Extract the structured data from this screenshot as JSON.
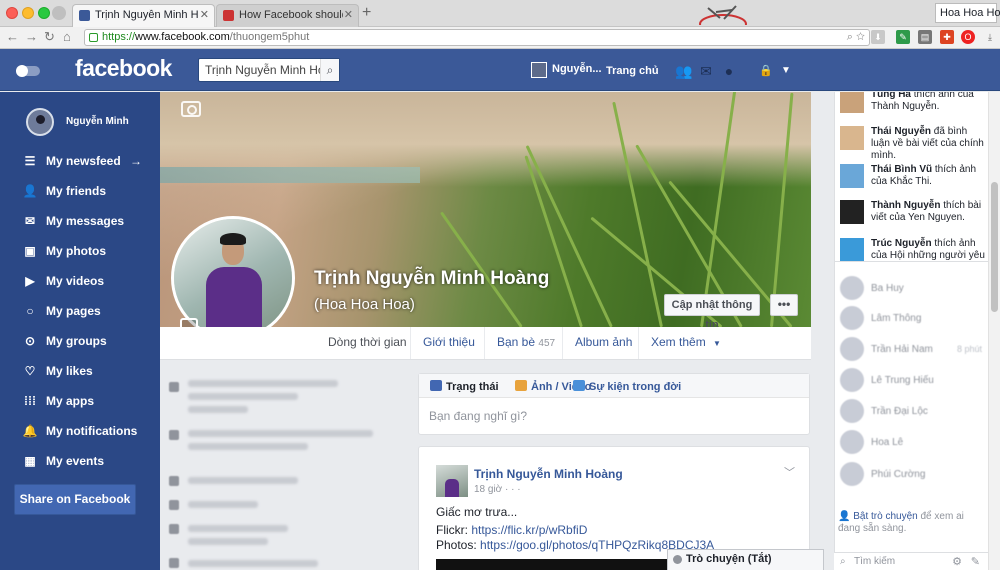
{
  "browser": {
    "tabs": [
      {
        "label": "Trịnh Nguyễn Minh Hoàng",
        "active": true
      },
      {
        "label": "How Facebook should be d",
        "active": false
      }
    ],
    "new_tab": "+",
    "profile_chip": "Hoa Hoa Hoa",
    "url": {
      "scheme": "https://",
      "host": "www.facebook.com",
      "path": "/thuongem5phut"
    },
    "colors": {
      "chrome": "#dcdcdc",
      "https": "#1e8a1e"
    }
  },
  "fb_header": {
    "logo": "facebook",
    "search_value": "Trịnh Nguyễn Minh Hoàn",
    "user_name": "Nguyễn...",
    "home": "Trang chủ",
    "colors": {
      "bar": "#3b5998"
    }
  },
  "sidebar": {
    "profile_name": "Nguyễn Minh",
    "items": [
      {
        "label": "My newsfeed",
        "icon": "menu-icon",
        "trail": "→"
      },
      {
        "label": "My friends",
        "icon": "friends-icon"
      },
      {
        "label": "My messages",
        "icon": "envelope-icon"
      },
      {
        "label": "My photos",
        "icon": "photo-icon"
      },
      {
        "label": "My videos",
        "icon": "video-icon"
      },
      {
        "label": "My pages",
        "icon": "flag-icon"
      },
      {
        "label": "My groups",
        "icon": "groups-icon"
      },
      {
        "label": "My likes",
        "icon": "heart-icon"
      },
      {
        "label": "My apps",
        "icon": "grid-icon"
      },
      {
        "label": "My notifications",
        "icon": "bell-icon"
      },
      {
        "label": "My events",
        "icon": "calendar-icon"
      }
    ],
    "share_button": "Share on Facebook",
    "colors": {
      "bg": "#2b4886",
      "share": "#4267b2"
    }
  },
  "profile": {
    "name": "Trịnh Nguyễn Minh Hoàng",
    "alt_name": "(Hoa Hoa Hoa)",
    "update_info": "Cập nhật thông tin",
    "more": "•••",
    "nav": [
      {
        "label": "Dòng thời gian",
        "active": true
      },
      {
        "label": "Giới thiệu"
      },
      {
        "label": "Bạn bè",
        "count": "457"
      },
      {
        "label": "Album ảnh"
      },
      {
        "label": "Xem thêm",
        "caret": "▼"
      }
    ]
  },
  "composer": {
    "tabs": [
      {
        "label": "Trạng thái",
        "color": "#4267b2"
      },
      {
        "label": "Ảnh / Video",
        "color": "#e8a33d"
      },
      {
        "label": "Sự kiện trong đời",
        "color": "#4a90d9"
      }
    ],
    "placeholder": "Bạn đang nghĩ gì?"
  },
  "post": {
    "author": "Trịnh Nguyễn Minh Hoàng",
    "time": "18 giờ · · ·",
    "text": "Giấc mơ trưa...",
    "links": [
      {
        "label": "Flickr:",
        "url": "https://flic.kr/p/wRbfiD"
      },
      {
        "label": "Photos:",
        "url": "https://goo.gl/photos/qTHPQzRikq8BDCJ3A"
      }
    ]
  },
  "chat_bar": "Trò chuyện (Tắt)",
  "ticker": [
    {
      "name": "Tùng Hà",
      "action": "thích ảnh của Thành Nguyễn.",
      "color": "#c9a27a"
    },
    {
      "name": "Thái Nguyễn",
      "action": "đã bình luận về bài viết của chính mình.",
      "color": "#d9b68e"
    },
    {
      "name": "Thái Bình Vũ",
      "action": "thích ảnh của Khắc Thi.",
      "color": "#6aa7d8"
    },
    {
      "name": "Thành Nguyễn",
      "action": "thích bài viết của Yen Nguyen.",
      "color": "#222222"
    },
    {
      "name": "Trúc Nguyễn",
      "action": "thích ảnh của Hội những người yêu chó",
      "color": "#3a9ad9"
    }
  ],
  "friends": [
    {
      "name": "Ba Huy",
      "time": ""
    },
    {
      "name": "Lâm Thông",
      "time": ""
    },
    {
      "name": "Trần Hải Nam",
      "time": "8 phút"
    },
    {
      "name": "Lê Trung Hiếu",
      "time": ""
    },
    {
      "name": "Trần Đại Lộc",
      "time": ""
    },
    {
      "name": "Hoa Lê",
      "time": ""
    },
    {
      "name": "Phúi Cường",
      "time": ""
    }
  ],
  "chat_on": {
    "link": "Bật trò chuyện",
    "rest": "để xem ai đang sẵn sàng."
  },
  "chat_search": "Tìm kiếm"
}
